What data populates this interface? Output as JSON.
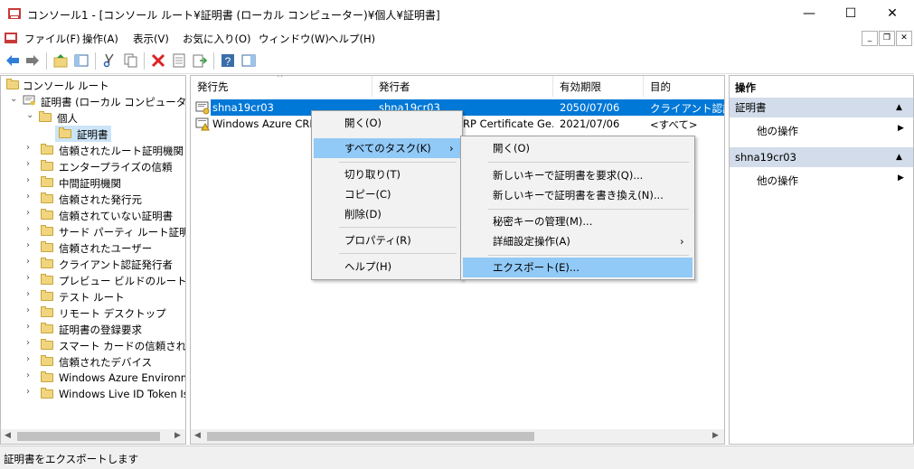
{
  "window": {
    "title": "コンソール1 - [コンソール ルート¥証明書 (ローカル コンピューター)¥個人¥証明書]",
    "minimize": "—",
    "maximize": "☐",
    "close": "✕"
  },
  "menubar": {
    "items": [
      "ファイル(F)",
      "操作(A)",
      "表示(V)",
      "お気に入り(O)",
      "ウィンドウ(W)",
      "ヘルプ(H)"
    ],
    "mdi_minimize": "_",
    "mdi_restore": "❐",
    "mdi_close": "✕"
  },
  "tree": {
    "items": [
      {
        "label": "コンソール ルート"
      },
      {
        "label": "証明書 (ローカル コンピューター)"
      },
      {
        "label": "個人"
      },
      {
        "label": "証明書"
      },
      {
        "label": "信頼されたルート証明機関"
      },
      {
        "label": "エンタープライズの信頼"
      },
      {
        "label": "中間証明機関"
      },
      {
        "label": "信頼された発行元"
      },
      {
        "label": "信頼されていない証明書"
      },
      {
        "label": "サード パーティ ルート証明機関"
      },
      {
        "label": "信頼されたユーザー"
      },
      {
        "label": "クライアント認証発行者"
      },
      {
        "label": "プレビュー ビルドのルート"
      },
      {
        "label": "テスト ルート"
      },
      {
        "label": "リモート デスクトップ"
      },
      {
        "label": "証明書の登録要求"
      },
      {
        "label": "スマート カードの信頼されたルート"
      },
      {
        "label": "信頼されたデバイス"
      },
      {
        "label": "Windows Azure Environment"
      },
      {
        "label": "Windows Live ID Token Issuer"
      }
    ]
  },
  "list": {
    "columns": [
      "発行先",
      "発行者",
      "有効期限",
      "目的"
    ],
    "rows": [
      {
        "issued_to": "shna19cr03",
        "issuer": "shna19cr03",
        "expires": "2050/07/06",
        "purpose": "クライアント認証,"
      },
      {
        "issued_to": "Windows Azure CRP",
        "issuer": "RP Certificate Ge...",
        "expires": "2021/07/06",
        "purpose": "<すべて>"
      }
    ]
  },
  "actions": {
    "header": "操作",
    "sections": [
      {
        "title": "証明書",
        "items": [
          "他の操作"
        ]
      },
      {
        "title": "shna19cr03",
        "items": [
          "他の操作"
        ]
      }
    ]
  },
  "context_menu": {
    "items": [
      "開く(O)",
      "すべてのタスク(K)",
      "切り取り(T)",
      "コピー(C)",
      "削除(D)",
      "プロパティ(R)",
      "ヘルプ(H)"
    ]
  },
  "submenu": {
    "items": [
      "開く(O)",
      "新しいキーで証明書を要求(Q)...",
      "新しいキーで証明書を書き換え(N)...",
      "秘密キーの管理(M)...",
      "詳細設定操作(A)",
      "エクスポート(E)..."
    ]
  },
  "statusbar": {
    "text": "証明書をエクスポートします"
  },
  "colors": {
    "selection": "#0078d7",
    "menu_highlight": "#91c9f7",
    "action_section": "#d2dcea"
  }
}
